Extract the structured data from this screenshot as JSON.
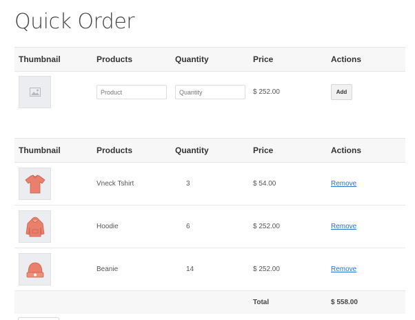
{
  "page": {
    "title": "Quick Order"
  },
  "add_form": {
    "headers": [
      "Thumbnail",
      "Products",
      "Quantity",
      "Price",
      "Actions"
    ],
    "product_placeholder": "Product",
    "quantity_placeholder": "Quantity",
    "price": "$ 252.00",
    "add_label": "Add",
    "thumbnail_icon": "image-placeholder-icon"
  },
  "order": {
    "headers": [
      "Thumbnail",
      "Products",
      "Quantity",
      "Price",
      "Actions"
    ],
    "items": [
      {
        "product": "Vneck Tshirt",
        "quantity": "3",
        "price": "$ 54.00",
        "action": "Remove",
        "icon": "tshirt-icon"
      },
      {
        "product": "Hoodie",
        "quantity": "6",
        "price": "$ 252.00",
        "action": "Remove",
        "icon": "hoodie-icon"
      },
      {
        "product": "Beanie",
        "quantity": "14",
        "price": "$ 252.00",
        "action": "Remove",
        "icon": "beanie-icon"
      }
    ],
    "total_label": "Total",
    "total_value": "$ 558.00"
  },
  "colors": {
    "link": "#2a6fd0",
    "product": "#e8806b",
    "header_bg": "#f7f7f7"
  }
}
